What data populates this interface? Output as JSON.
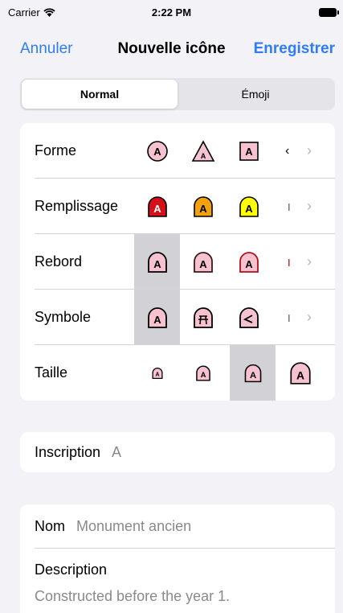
{
  "status": {
    "carrier": "Carrier",
    "time": "2:22 PM"
  },
  "nav": {
    "cancel": "Annuler",
    "title": "Nouvelle icône",
    "save": "Enregistrer"
  },
  "segments": {
    "normal": "Normal",
    "emoji": "Émoji",
    "selected": "Normal"
  },
  "rows": {
    "shape": "Forme",
    "fill": "Remplissage",
    "border": "Rebord",
    "symbol": "Symbole",
    "size": "Taille"
  },
  "glyph_letter": "A",
  "inscription": {
    "label": "Inscription",
    "value": "A"
  },
  "name": {
    "label": "Nom",
    "value": "Monument ancien"
  },
  "description": {
    "label": "Description",
    "value": "Constructed before the year 1."
  },
  "colors": {
    "accent": "#2f7cf6",
    "pink": "#f7c2cf",
    "red": "#d4101a",
    "orange": "#f2a20c",
    "yellow": "#ffff00"
  }
}
